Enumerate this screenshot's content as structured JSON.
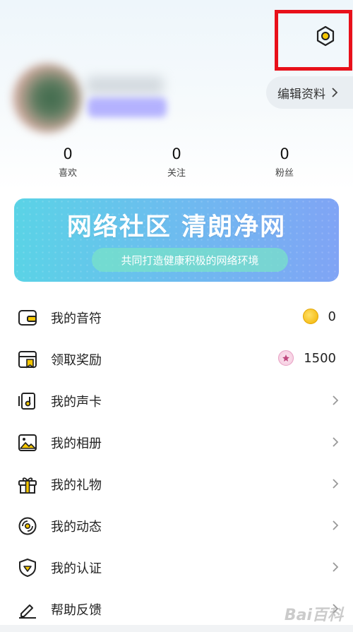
{
  "profile": {
    "edit_label": "编辑资料"
  },
  "stats": [
    {
      "value": "0",
      "label": "喜欢"
    },
    {
      "value": "0",
      "label": "关注"
    },
    {
      "value": "0",
      "label": "粉丝"
    }
  ],
  "banner": {
    "title": "网络社区 清朗净网",
    "subtitle": "共同打造健康积极的网络环境"
  },
  "menu": [
    {
      "label": "我的音符",
      "icon": "wallet-icon",
      "value": "0",
      "value_icon": "coin-icon"
    },
    {
      "label": "领取奖励",
      "icon": "reward-card-icon",
      "value": "1500",
      "value_icon": "gem-icon"
    },
    {
      "label": "我的声卡",
      "icon": "music-card-icon"
    },
    {
      "label": "我的相册",
      "icon": "photo-icon"
    },
    {
      "label": "我的礼物",
      "icon": "gift-icon"
    },
    {
      "label": "我的动态",
      "icon": "vinyl-icon"
    },
    {
      "label": "我的认证",
      "icon": "shield-icon"
    },
    {
      "label": "帮助反馈",
      "icon": "pencil-icon"
    }
  ],
  "watermark": "Bai百科",
  "colors": {
    "accent_yellow": "#f6c700",
    "highlight_red": "#e8101a",
    "banner_start": "#5ad3e6",
    "banner_end": "#80a4f5"
  }
}
